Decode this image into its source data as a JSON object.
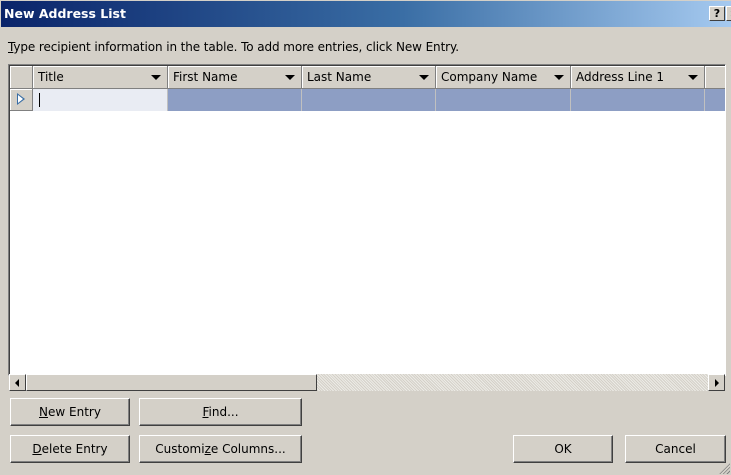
{
  "window": {
    "title": "New Address List",
    "help_label": "?",
    "close_label": "×"
  },
  "instruction": {
    "accel": "T",
    "text": "ype recipient information in the table.  To add more entries, click New Entry."
  },
  "table": {
    "columns": [
      {
        "label": "Title"
      },
      {
        "label": "First Name"
      },
      {
        "label": "Last Name"
      },
      {
        "label": "Company Name"
      },
      {
        "label": "Address Line 1"
      }
    ],
    "rows": [
      {
        "values": [
          "",
          "",
          "",
          "",
          ""
        ],
        "active_cell": 0
      }
    ]
  },
  "buttons": {
    "new_entry": {
      "accel": "N",
      "rest": "ew Entry"
    },
    "find": {
      "accel": "F",
      "rest": "ind..."
    },
    "delete_entry": {
      "accel": "D",
      "rest": "elete Entry"
    },
    "customize_columns": {
      "pre": "Customi",
      "accel": "z",
      "rest": "e Columns..."
    },
    "ok": "OK",
    "cancel": "Cancel"
  },
  "colors": {
    "title_bar_start": "#0a246a",
    "selected_row": "#8d9ec4",
    "dialog_face": "#d4d0c8"
  }
}
